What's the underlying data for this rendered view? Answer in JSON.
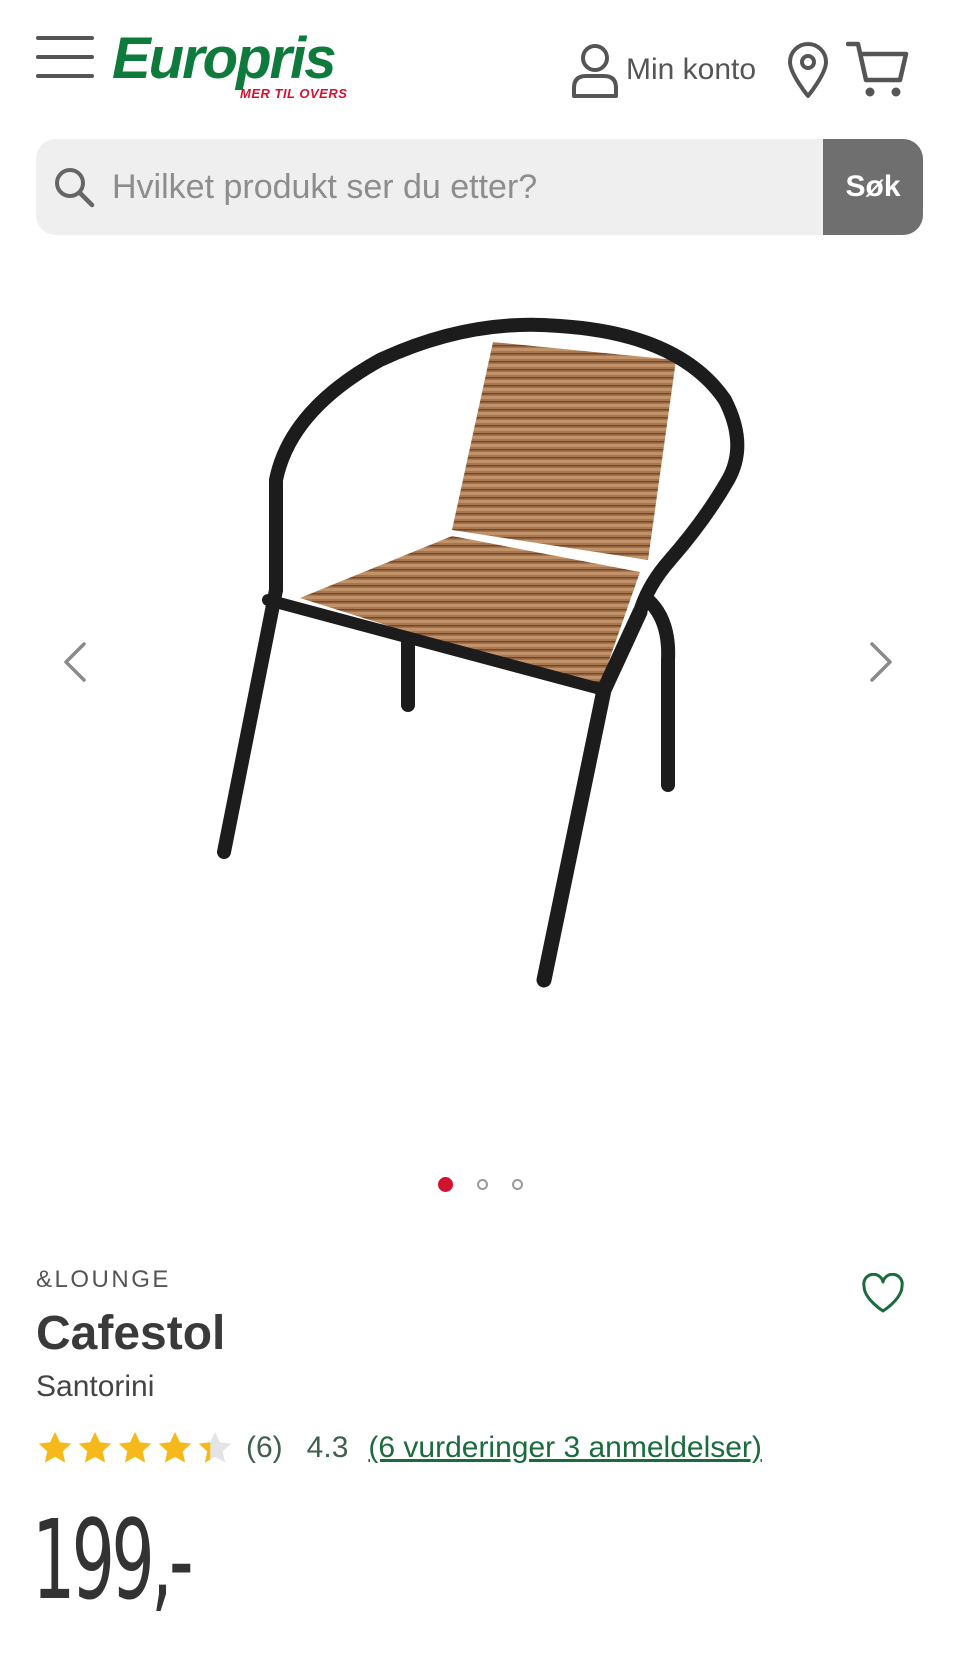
{
  "header": {
    "logo_text": "Europris",
    "logo_tagline": "MER TIL OVERS",
    "account_label": "Min konto"
  },
  "search": {
    "placeholder": "Hvilket produkt ser du etter?",
    "value": "",
    "button_label": "Søk"
  },
  "gallery": {
    "image_count": 3,
    "active_index": 0
  },
  "product": {
    "brand": "&LOUNGE",
    "title": "Cafestol",
    "subtitle": "Santorini",
    "rating": {
      "stars": 4.3,
      "count_label": "(6)",
      "value_label": "4.3",
      "reviews_link": "(6 vurderinger 3 anmeldelser)"
    },
    "price": "199,-"
  },
  "colors": {
    "brand_green": "#0e7a3c",
    "brand_red": "#d3122f",
    "star_yellow": "#f6b91a",
    "search_button": "#6f6f6f"
  },
  "icons": [
    "menu-icon",
    "user-icon",
    "location-pin-icon",
    "cart-icon",
    "search-icon",
    "chevron-left-icon",
    "chevron-right-icon",
    "heart-icon",
    "star-icon"
  ]
}
